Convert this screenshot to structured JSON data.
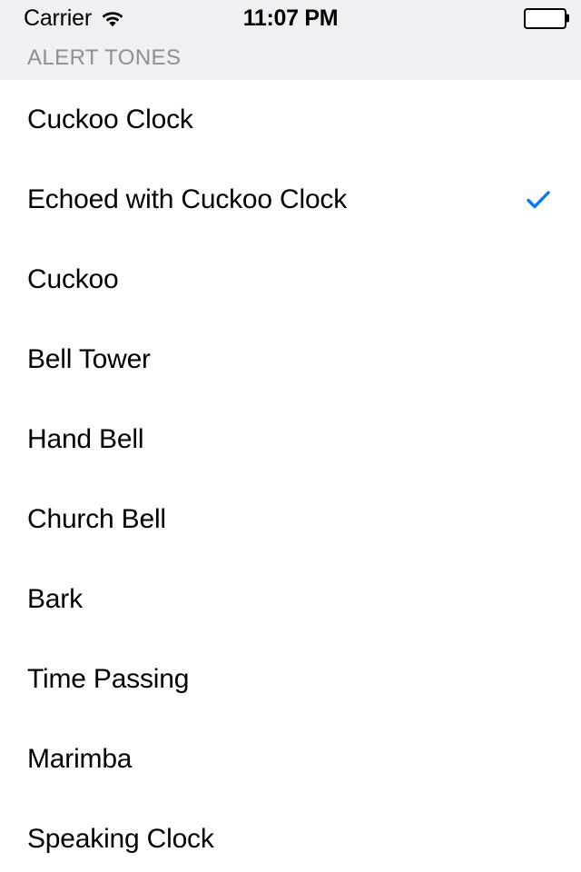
{
  "status_bar": {
    "carrier": "Carrier",
    "wifi_icon": "wifi-icon",
    "time": "11:07 PM",
    "battery_icon": "battery-icon",
    "battery_level_percent": 100
  },
  "section": {
    "header": "ALERT TONES"
  },
  "theme": {
    "accent": "#007AFF",
    "chrome_background": "#EFEFF4",
    "list_background": "#FFFFFF",
    "primary_text": "#000000",
    "header_text": "#8E8E93"
  },
  "tones": [
    {
      "label": "Cuckoo Clock",
      "selected": false
    },
    {
      "label": "Echoed with Cuckoo Clock",
      "selected": true
    },
    {
      "label": "Cuckoo",
      "selected": false
    },
    {
      "label": "Bell Tower",
      "selected": false
    },
    {
      "label": "Hand Bell",
      "selected": false
    },
    {
      "label": "Church Bell",
      "selected": false
    },
    {
      "label": "Bark",
      "selected": false
    },
    {
      "label": "Time Passing",
      "selected": false
    },
    {
      "label": "Marimba",
      "selected": false
    },
    {
      "label": "Speaking Clock",
      "selected": false
    }
  ]
}
